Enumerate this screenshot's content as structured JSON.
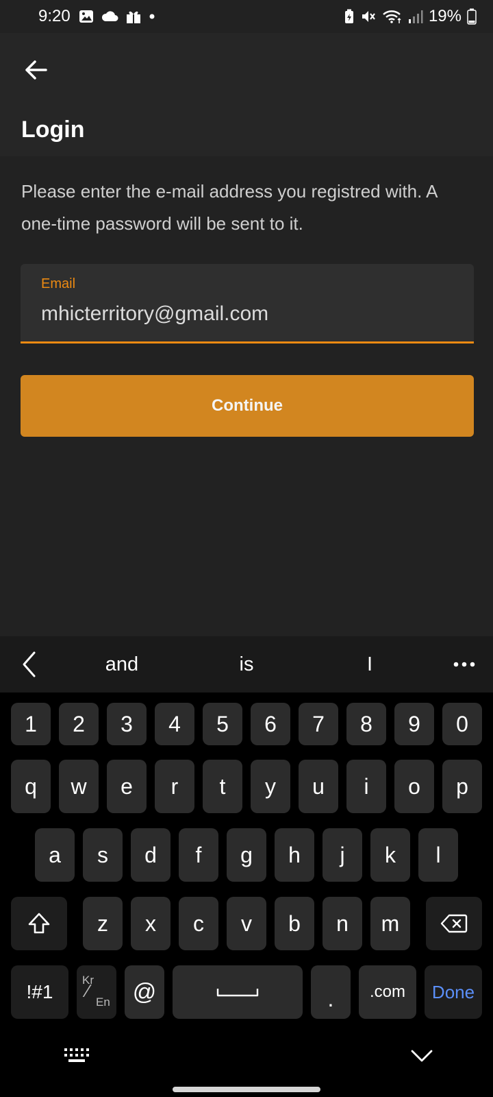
{
  "status_bar": {
    "time": "9:20",
    "battery": "19%",
    "left_icons": [
      "image-icon",
      "cloud-icon",
      "gift-icon",
      "dot-icon"
    ],
    "right_icons": [
      "battery-saver-icon",
      "mute-icon",
      "wifi-icon",
      "signal-icon",
      "battery-icon"
    ]
  },
  "app_bar": {
    "title": "Login"
  },
  "main": {
    "instructions": "Please enter the e-mail address you registred with. A one-time password will be sent to it.",
    "email": {
      "label": "Email",
      "value": "mhicterritory@gmail.com"
    },
    "continue_label": "Continue"
  },
  "suggestions": [
    "and",
    "is",
    "I"
  ],
  "keyboard": {
    "number_row": [
      "1",
      "2",
      "3",
      "4",
      "5",
      "6",
      "7",
      "8",
      "9",
      "0"
    ],
    "row1": [
      "q",
      "w",
      "e",
      "r",
      "t",
      "y",
      "u",
      "i",
      "o",
      "p"
    ],
    "row2": [
      "a",
      "s",
      "d",
      "f",
      "g",
      "h",
      "j",
      "k",
      "l"
    ],
    "row3": [
      "z",
      "x",
      "c",
      "v",
      "b",
      "n",
      "m"
    ],
    "symbols_label": "!#1",
    "lang_top": "Kr",
    "lang_bottom": "En",
    "at_label": "@",
    "period_label": ".",
    "dotcom_label": ".com",
    "done_label": "Done",
    "done_color": "#5b8ff9"
  },
  "colors": {
    "accent": "#ec8a12",
    "button": "#d28620"
  }
}
